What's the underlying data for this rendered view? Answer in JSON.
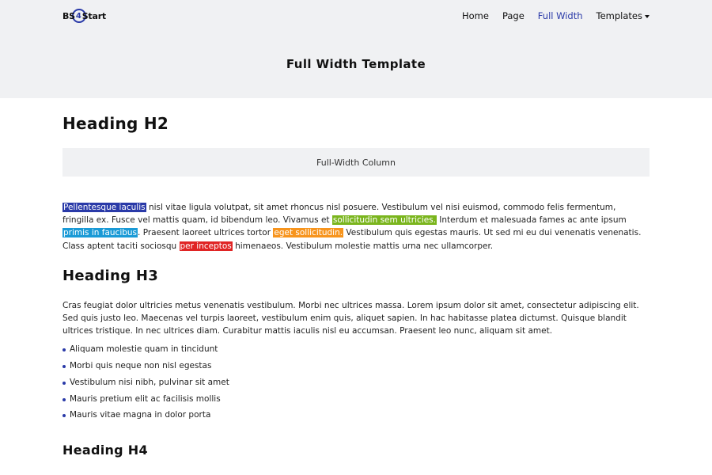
{
  "brand": {
    "part1": "BS",
    "part2": "4",
    "part3": "Start"
  },
  "nav": {
    "items": [
      {
        "label": "Home"
      },
      {
        "label": "Page"
      },
      {
        "label": "Full Width"
      },
      {
        "label": "Templates"
      }
    ],
    "active": "Full Width"
  },
  "page_title": "Full Width Template",
  "main": {
    "h2": "Heading H2",
    "column_label": "Full-Width Column",
    "paragraph1": {
      "hl1": "Pellentesque iaculis",
      "t1": " nisl vitae ligula volutpat, sit amet rhoncus nisl posuere. Vestibulum vel nisi euismod, commodo felis fermentum, fringilla ex. Fusce vel mattis quam, id bibendum leo. Vivamus et ",
      "hl2": "sollicitudin sem ultricies.",
      "t2": " Interdum et malesuada fames ac ante ipsum ",
      "hl3": "primis in faucibus",
      "t3": ". Praesent laoreet ultrices tortor ",
      "hl4": "eget sollicitudin.",
      "t4": " Vestibulum quis egestas mauris. Ut sed mi eu dui venenatis venenatis. Class aptent taciti sociosqu ",
      "hl5": "per inceptos",
      "t5": " himenaeos. Vestibulum molestie mattis urna nec ullamcorper."
    },
    "h3": "Heading H3",
    "paragraph2": "Cras feugiat dolor ultricies metus venenatis vestibulum. Morbi nec ultrices massa. Lorem ipsum dolor sit amet, consectetur adipiscing elit. Sed quis justo leo. Maecenas vel turpis laoreet, vestibulum enim quis, aliquet sapien. In hac habitasse platea dictumst. Quisque blandit ultrices tristique. In nec ultrices diam. Curabitur mattis iaculis nisl eu accumsan. Praesent leo nunc, aliquam sit amet.",
    "list": [
      "Aliquam molestie quam in tincidunt",
      "Morbi quis neque non nisl egestas",
      "Vestibulum nisi nibh, pulvinar sit amet",
      "Mauris pretium elit ac facilisis mollis",
      "Mauris vitae magna in dolor porta"
    ],
    "h4": "Heading H4"
  },
  "colors": {
    "accent": "#2a3aa8",
    "highlight_blue": "#2a3aa8",
    "highlight_green": "#7ab51d",
    "highlight_cyan": "#1a9ad6",
    "highlight_orange": "#f7941d",
    "highlight_red": "#e02424",
    "header_bg": "#f0f1f3"
  },
  "icons": {
    "templates_dropdown": "caret-down-icon",
    "bullet": "bullet-dot-icon"
  }
}
